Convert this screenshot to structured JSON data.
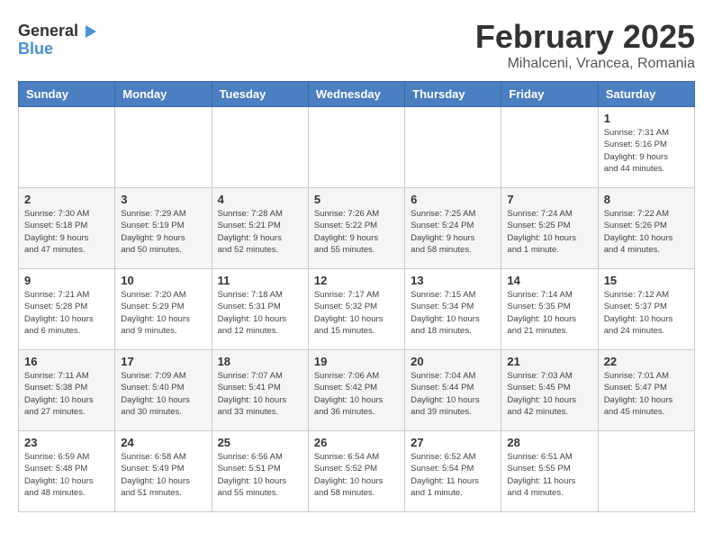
{
  "header": {
    "logo_line1": "General",
    "logo_line2": "Blue",
    "title": "February 2025",
    "subtitle": "Mihalceni, Vrancea, Romania"
  },
  "weekdays": [
    "Sunday",
    "Monday",
    "Tuesday",
    "Wednesday",
    "Thursday",
    "Friday",
    "Saturday"
  ],
  "weeks": [
    [
      {
        "day": "",
        "info": ""
      },
      {
        "day": "",
        "info": ""
      },
      {
        "day": "",
        "info": ""
      },
      {
        "day": "",
        "info": ""
      },
      {
        "day": "",
        "info": ""
      },
      {
        "day": "",
        "info": ""
      },
      {
        "day": "1",
        "info": "Sunrise: 7:31 AM\nSunset: 5:16 PM\nDaylight: 9 hours\nand 44 minutes."
      }
    ],
    [
      {
        "day": "2",
        "info": "Sunrise: 7:30 AM\nSunset: 5:18 PM\nDaylight: 9 hours\nand 47 minutes."
      },
      {
        "day": "3",
        "info": "Sunrise: 7:29 AM\nSunset: 5:19 PM\nDaylight: 9 hours\nand 50 minutes."
      },
      {
        "day": "4",
        "info": "Sunrise: 7:28 AM\nSunset: 5:21 PM\nDaylight: 9 hours\nand 52 minutes."
      },
      {
        "day": "5",
        "info": "Sunrise: 7:26 AM\nSunset: 5:22 PM\nDaylight: 9 hours\nand 55 minutes."
      },
      {
        "day": "6",
        "info": "Sunrise: 7:25 AM\nSunset: 5:24 PM\nDaylight: 9 hours\nand 58 minutes."
      },
      {
        "day": "7",
        "info": "Sunrise: 7:24 AM\nSunset: 5:25 PM\nDaylight: 10 hours\nand 1 minute."
      },
      {
        "day": "8",
        "info": "Sunrise: 7:22 AM\nSunset: 5:26 PM\nDaylight: 10 hours\nand 4 minutes."
      }
    ],
    [
      {
        "day": "9",
        "info": "Sunrise: 7:21 AM\nSunset: 5:28 PM\nDaylight: 10 hours\nand 6 minutes."
      },
      {
        "day": "10",
        "info": "Sunrise: 7:20 AM\nSunset: 5:29 PM\nDaylight: 10 hours\nand 9 minutes."
      },
      {
        "day": "11",
        "info": "Sunrise: 7:18 AM\nSunset: 5:31 PM\nDaylight: 10 hours\nand 12 minutes."
      },
      {
        "day": "12",
        "info": "Sunrise: 7:17 AM\nSunset: 5:32 PM\nDaylight: 10 hours\nand 15 minutes."
      },
      {
        "day": "13",
        "info": "Sunrise: 7:15 AM\nSunset: 5:34 PM\nDaylight: 10 hours\nand 18 minutes."
      },
      {
        "day": "14",
        "info": "Sunrise: 7:14 AM\nSunset: 5:35 PM\nDaylight: 10 hours\nand 21 minutes."
      },
      {
        "day": "15",
        "info": "Sunrise: 7:12 AM\nSunset: 5:37 PM\nDaylight: 10 hours\nand 24 minutes."
      }
    ],
    [
      {
        "day": "16",
        "info": "Sunrise: 7:11 AM\nSunset: 5:38 PM\nDaylight: 10 hours\nand 27 minutes."
      },
      {
        "day": "17",
        "info": "Sunrise: 7:09 AM\nSunset: 5:40 PM\nDaylight: 10 hours\nand 30 minutes."
      },
      {
        "day": "18",
        "info": "Sunrise: 7:07 AM\nSunset: 5:41 PM\nDaylight: 10 hours\nand 33 minutes."
      },
      {
        "day": "19",
        "info": "Sunrise: 7:06 AM\nSunset: 5:42 PM\nDaylight: 10 hours\nand 36 minutes."
      },
      {
        "day": "20",
        "info": "Sunrise: 7:04 AM\nSunset: 5:44 PM\nDaylight: 10 hours\nand 39 minutes."
      },
      {
        "day": "21",
        "info": "Sunrise: 7:03 AM\nSunset: 5:45 PM\nDaylight: 10 hours\nand 42 minutes."
      },
      {
        "day": "22",
        "info": "Sunrise: 7:01 AM\nSunset: 5:47 PM\nDaylight: 10 hours\nand 45 minutes."
      }
    ],
    [
      {
        "day": "23",
        "info": "Sunrise: 6:59 AM\nSunset: 5:48 PM\nDaylight: 10 hours\nand 48 minutes."
      },
      {
        "day": "24",
        "info": "Sunrise: 6:58 AM\nSunset: 5:49 PM\nDaylight: 10 hours\nand 51 minutes."
      },
      {
        "day": "25",
        "info": "Sunrise: 6:56 AM\nSunset: 5:51 PM\nDaylight: 10 hours\nand 55 minutes."
      },
      {
        "day": "26",
        "info": "Sunrise: 6:54 AM\nSunset: 5:52 PM\nDaylight: 10 hours\nand 58 minutes."
      },
      {
        "day": "27",
        "info": "Sunrise: 6:52 AM\nSunset: 5:54 PM\nDaylight: 11 hours\nand 1 minute."
      },
      {
        "day": "28",
        "info": "Sunrise: 6:51 AM\nSunset: 5:55 PM\nDaylight: 11 hours\nand 4 minutes."
      },
      {
        "day": "",
        "info": ""
      }
    ]
  ]
}
